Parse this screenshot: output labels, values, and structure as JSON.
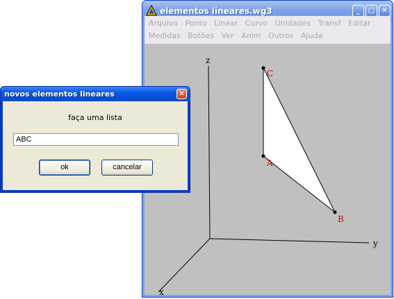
{
  "main_window": {
    "title": "elementos lineares.wg3",
    "controls": {
      "minimize": "_",
      "maximize": "□",
      "close": "✕"
    },
    "menu_row1": [
      "Arquivo",
      "Ponto",
      "Linear",
      "Curvo",
      "Unidades",
      "Transf",
      "Editar"
    ],
    "menu_row2": [
      "Medidas",
      "Botões",
      "Ver",
      "Anim",
      "Outros",
      "Ajuda"
    ],
    "icons": {
      "app": "geometry-triangle-icon"
    }
  },
  "canvas": {
    "axes": {
      "z": "z",
      "y": "y",
      "x": "x"
    },
    "points": {
      "a": "A",
      "b": "B",
      "c": "C"
    }
  },
  "dialog": {
    "title": "novos elementos lineares",
    "prompt": "faça uma lista",
    "input_value": "ABC",
    "ok_label": "ok",
    "cancel_label": "cancelar",
    "close": "✕"
  },
  "colors": {
    "canvas_bg": "#c0c0c0",
    "point_label": "#cc0000",
    "titlebar_active": "#0a58e6",
    "titlebar_inactive": "#7ea1e6"
  }
}
